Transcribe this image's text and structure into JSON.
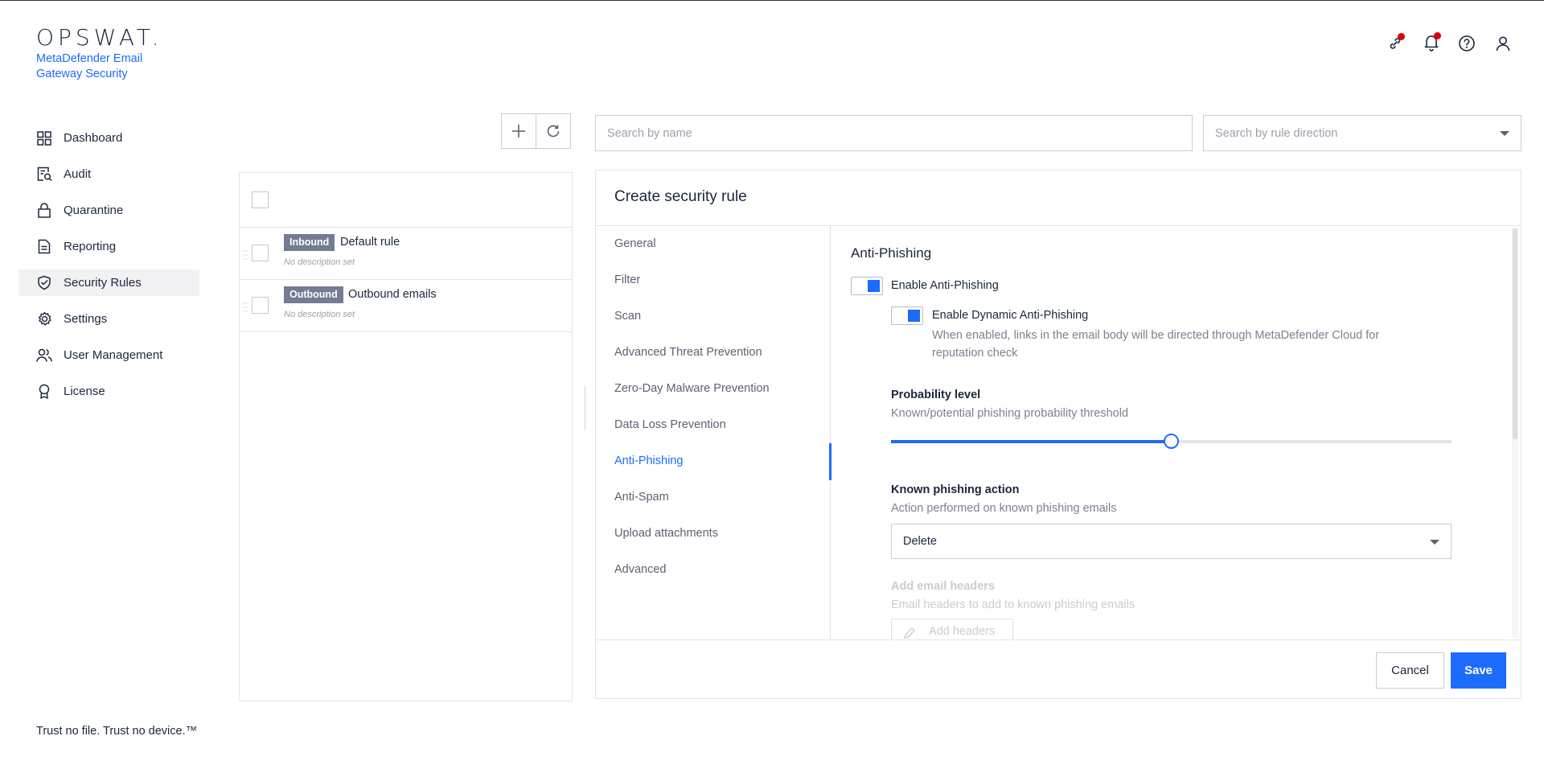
{
  "brand": {
    "logo": "OPSWAT.",
    "product": "MetaDefender Email Gateway Security",
    "tagline": "Trust no file. Trust no device.™"
  },
  "topbar": {
    "icons": [
      "link-icon",
      "bell-icon",
      "help-icon",
      "user-icon"
    ]
  },
  "sidebar": {
    "items": [
      {
        "label": "Dashboard",
        "icon": "dashboard-icon"
      },
      {
        "label": "Audit",
        "icon": "audit-icon"
      },
      {
        "label": "Quarantine",
        "icon": "lock-icon"
      },
      {
        "label": "Reporting",
        "icon": "document-icon"
      },
      {
        "label": "Security Rules",
        "icon": "shield-check-icon",
        "active": true
      },
      {
        "label": "Settings",
        "icon": "gear-icon"
      },
      {
        "label": "User Management",
        "icon": "users-icon"
      },
      {
        "label": "License",
        "icon": "award-icon"
      }
    ]
  },
  "rules_list": {
    "rows": [
      {
        "badge": "Inbound",
        "title": "Default rule",
        "desc": "No description set"
      },
      {
        "badge": "Outbound",
        "title": "Outbound emails",
        "desc": "No description set"
      }
    ]
  },
  "search": {
    "name_placeholder": "Search by name",
    "direction_placeholder": "Search by rule direction"
  },
  "card": {
    "title": "Create security rule",
    "tabs": [
      {
        "label": "General"
      },
      {
        "label": "Filter"
      },
      {
        "label": "Scan"
      },
      {
        "label": "Advanced Threat Prevention"
      },
      {
        "label": "Zero-Day Malware Prevention"
      },
      {
        "label": "Data Loss Prevention"
      },
      {
        "label": "Anti-Phishing",
        "active": true
      },
      {
        "label": "Anti-Spam"
      },
      {
        "label": "Upload attachments"
      },
      {
        "label": "Advanced"
      }
    ],
    "cancel_label": "Cancel",
    "save_label": "Save"
  },
  "anti_phishing": {
    "section_title": "Anti-Phishing",
    "enable_label": "Enable Anti-Phishing",
    "enable_on": true,
    "dynamic_label": "Enable Dynamic Anti-Phishing",
    "dynamic_on": true,
    "dynamic_hint": "When enabled, links in the email body will be directed through MetaDefender Cloud for reputation check",
    "probability_label": "Probability level",
    "probability_hint": "Known/potential phishing probability threshold",
    "probability_value": 0.5,
    "known_action_label": "Known phishing action",
    "known_action_hint": "Action performed on known phishing emails",
    "known_action_value": "Delete",
    "headers_label": "Add email headers",
    "headers_hint": "Email headers to add to known phishing emails",
    "headers_button": "Add headers"
  },
  "colors": {
    "accent": "#1d6bfc",
    "text": "#1b273d",
    "badge": "#737c92",
    "notification": "#e00000"
  }
}
